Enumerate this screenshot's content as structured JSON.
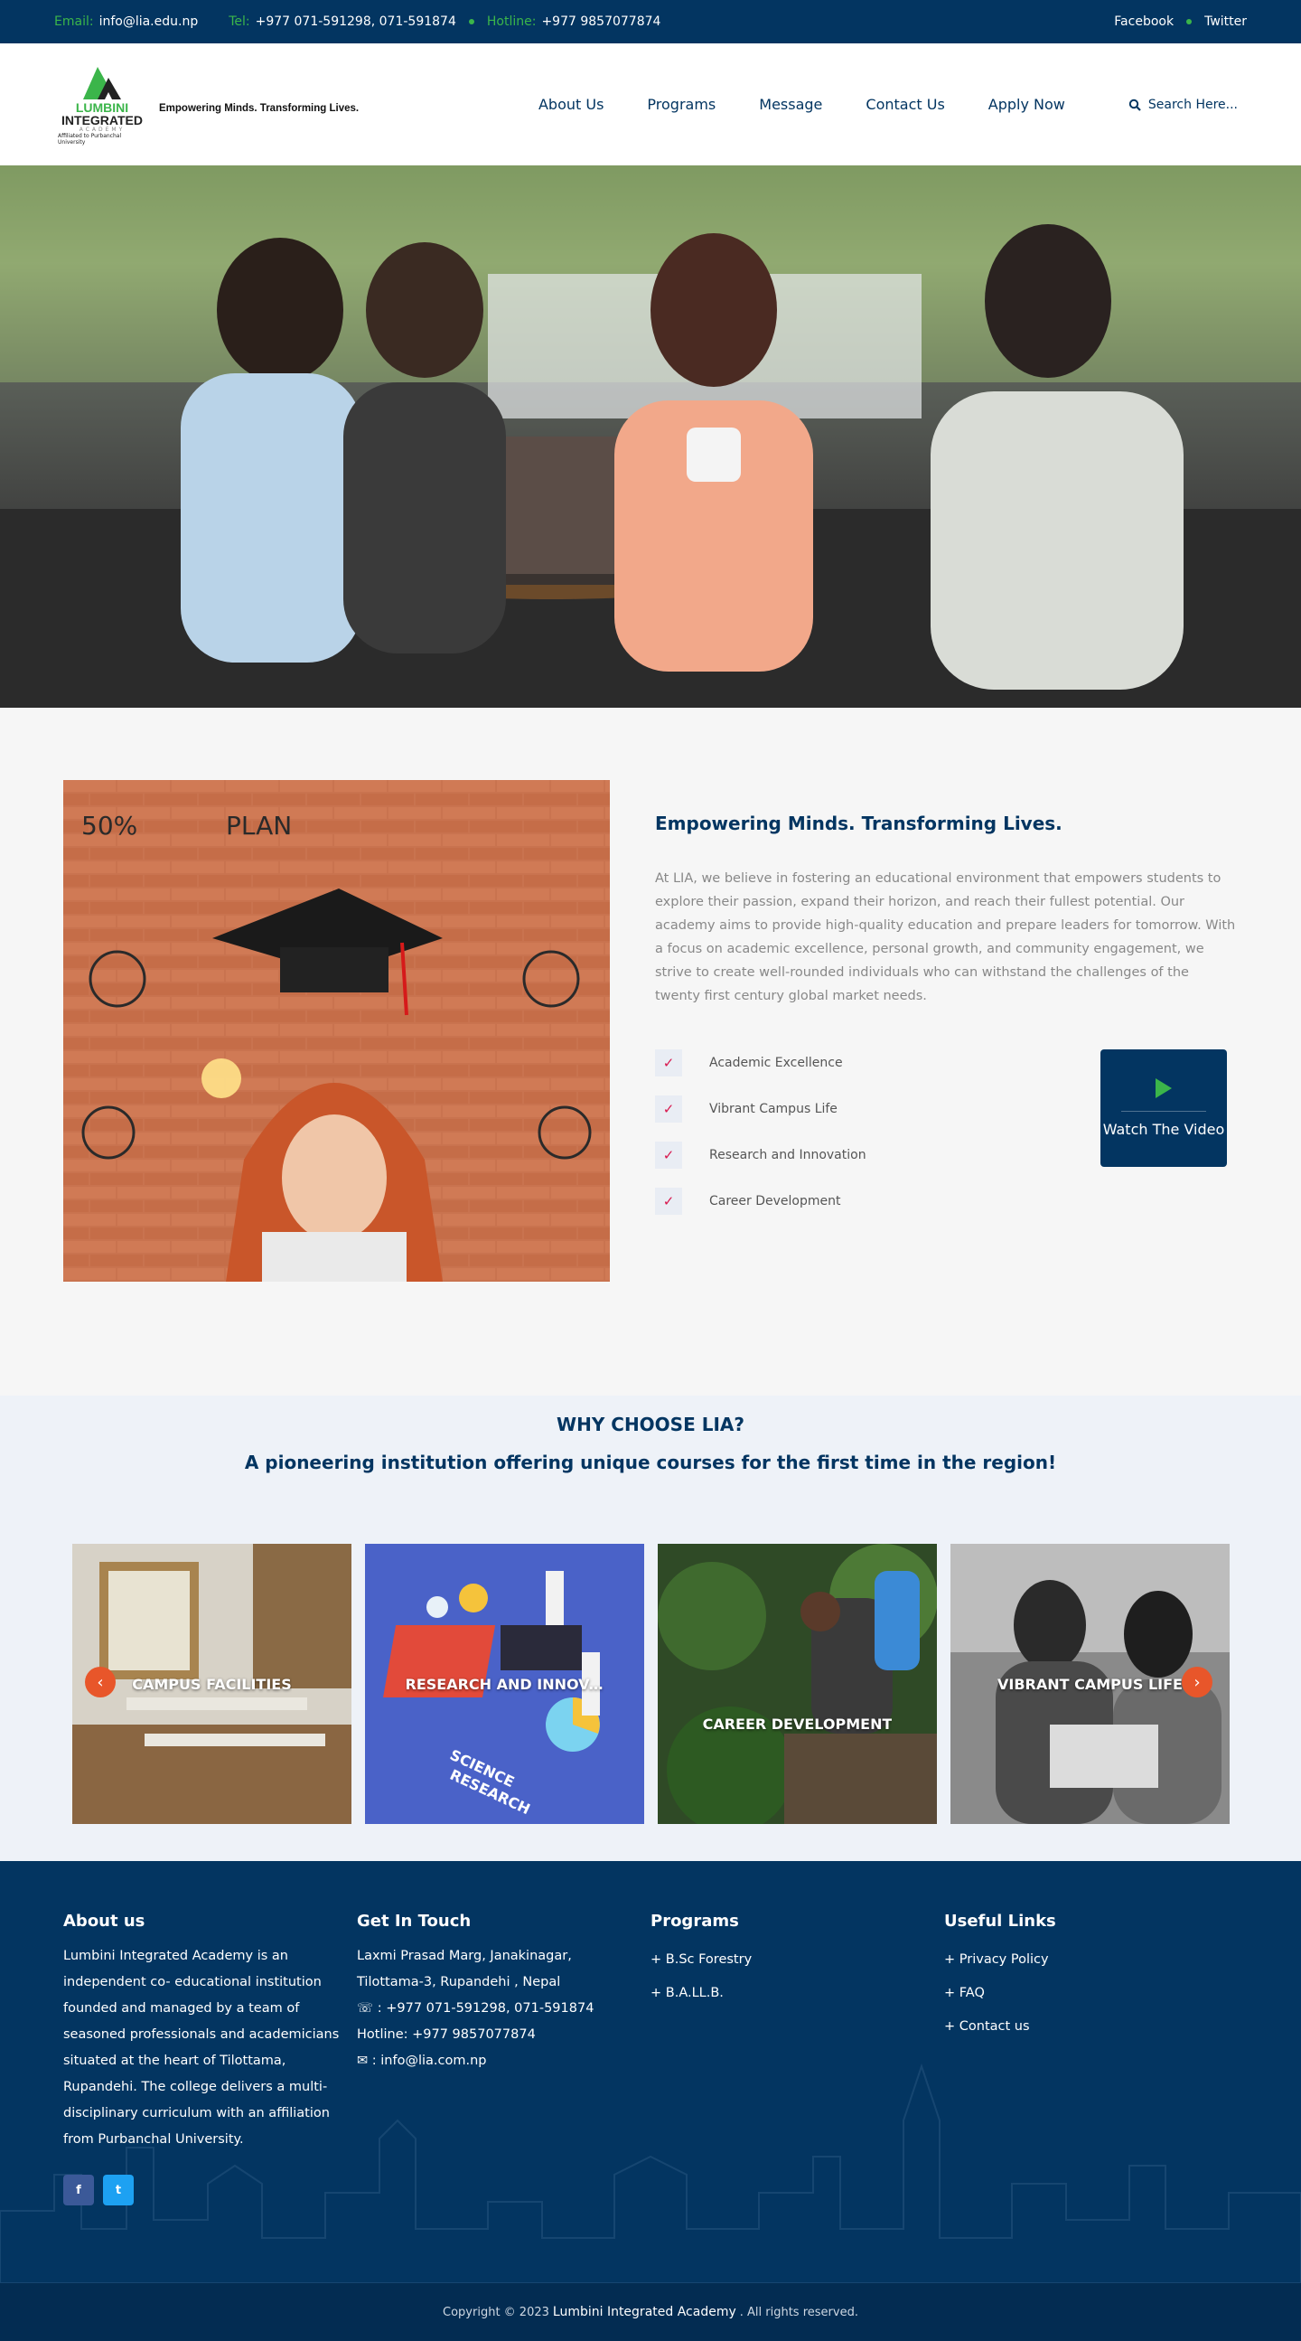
{
  "topbar": {
    "email_label": "Email:",
    "email": "info@lia.edu.np",
    "tel_label": "Tel:",
    "tel": "+977 071-591298, 071-591874",
    "hotline_label": "Hotline:",
    "hotline": "+977 9857077874",
    "facebook": "Facebook",
    "twitter": "Twitter"
  },
  "header": {
    "logo_line1": "LUMBINI",
    "logo_line2": "INTEGRATED",
    "logo_line3": "ACADEMY",
    "logo_affiliation": "Affiliated to Purbanchal University",
    "tagline": "Empowering Minds. Transforming Lives.",
    "nav": [
      "About Us",
      "Programs",
      "Message",
      "Contact Us",
      "Apply Now"
    ],
    "search_label": "Search Here..."
  },
  "about": {
    "heading": "Empowering Minds. Transforming Lives.",
    "body": "At LIA, we believe in fostering an educational environment that empowers students to explore their passion, expand their horizon, and reach their fullest potential. Our academy aims to provide high-quality education and prepare leaders for tomorrow. With a focus on academic excellence, personal growth, and community engagement, we strive to create well-rounded individuals who can withstand the challenges of the twenty first century global market needs.",
    "features": [
      "Academic Excellence",
      "Vibrant Campus Life",
      "Research and Innovation",
      "Career Development"
    ],
    "video_label": "Watch The Video"
  },
  "why": {
    "title": "WHY CHOOSE LIA?",
    "subtitle": "A pioneering institution offering unique courses for the first time in the region!",
    "cards": [
      "CAMPUS FACILITIES",
      "RESEARCH AND INNOVATION",
      "CAREER DEVELOPMENT",
      "VIBRANT CAMPUS LIFE"
    ]
  },
  "footer": {
    "about_title": "About us",
    "about_text": "Lumbini Integrated Academy is an independent co- educational institution founded and managed by a team of seasoned professionals and academicians situated at the heart of Tilottama, Rupandehi. The college delivers a multi-disciplinary curriculum with an affiliation from Purbanchal University.",
    "contact_title": "Get In Touch",
    "address1": "Laxmi Prasad Marg, Janakinagar,",
    "address2": "Tilottama-3, Rupandehi , Nepal",
    "phone": " : +977 071-591298, 071-591874",
    "hotline": "Hotline: +977 9857077874",
    "email": " : info@lia.com.np",
    "programs_title": "Programs",
    "programs": [
      "B.Sc Forestry",
      "B.A.LL.B."
    ],
    "links_title": "Useful Links",
    "links": [
      "Privacy Policy",
      "FAQ",
      "Contact us"
    ]
  },
  "copyright": {
    "prefix": "Copyright © 2023",
    "name": "Lumbini Integrated Academy",
    "suffix": ". All rights reserved."
  },
  "colors": {
    "primary": "#033561",
    "accent_green": "#3bb54a",
    "check_red": "#d8174d",
    "arrow_orange": "#e8562a"
  }
}
